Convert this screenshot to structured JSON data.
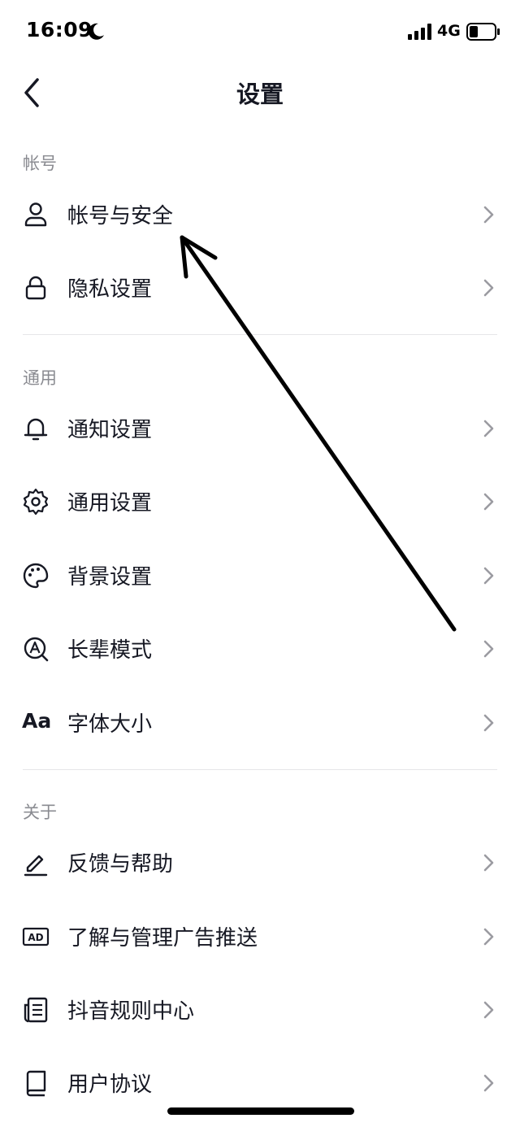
{
  "status_bar": {
    "time": "16:09",
    "network": "4G"
  },
  "nav": {
    "title": "设置"
  },
  "sections": [
    {
      "label": "帐号",
      "items": [
        {
          "label": "帐号与安全",
          "icon": "person-icon"
        },
        {
          "label": "隐私设置",
          "icon": "lock-icon"
        }
      ]
    },
    {
      "label": "通用",
      "items": [
        {
          "label": "通知设置",
          "icon": "bell-icon"
        },
        {
          "label": "通用设置",
          "icon": "gear-icon"
        },
        {
          "label": "背景设置",
          "icon": "palette-icon"
        },
        {
          "label": "长辈模式",
          "icon": "elder-mode-icon"
        },
        {
          "label": "字体大小",
          "icon": "font-size-icon",
          "icon_text": "Aa"
        }
      ]
    },
    {
      "label": "关于",
      "items": [
        {
          "label": "反馈与帮助",
          "icon": "pencil-icon"
        },
        {
          "label": "了解与管理广告推送",
          "icon": "ad-icon",
          "icon_text": "AD"
        },
        {
          "label": "抖音规则中心",
          "icon": "document-icon"
        },
        {
          "label": "用户协议",
          "icon": "book-icon"
        }
      ]
    }
  ],
  "colors": {
    "text": "#161823",
    "secondary": "#8a8b91",
    "divider": "#e6e6e8",
    "chevron": "#9b9ba1"
  }
}
